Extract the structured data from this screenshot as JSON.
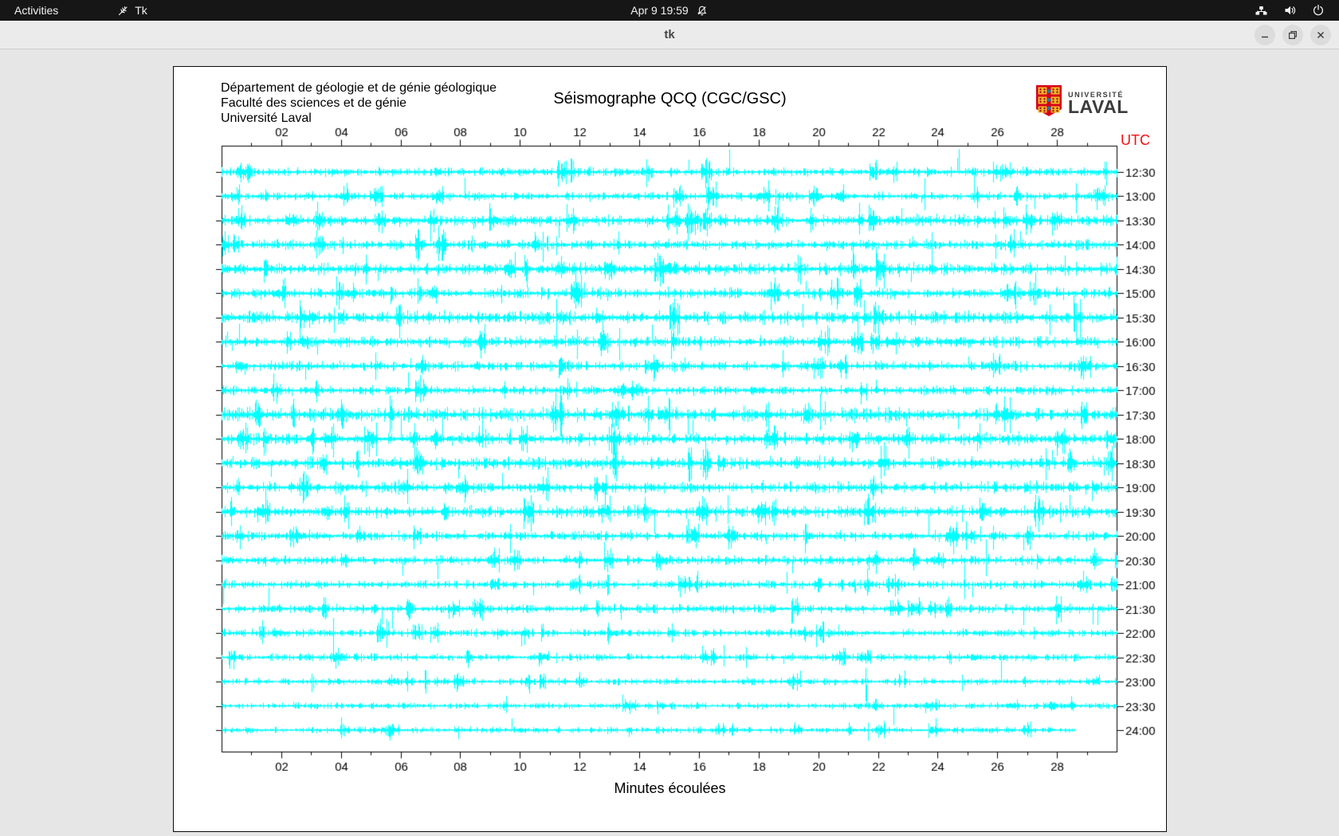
{
  "top_bar": {
    "activities_label": "Activities",
    "app_name": "Tk",
    "clock": "Apr 9 19:59",
    "icons": [
      "tk-feather-icon",
      "bell-muted-icon",
      "network-tree-icon",
      "speaker-icon",
      "power-icon"
    ]
  },
  "window": {
    "title": "tk",
    "buttons": [
      "minimize",
      "maximize",
      "close"
    ]
  },
  "chart": {
    "header_lines": [
      "Département de géologie et de génie géologique",
      "Faculté des sciences et de génie",
      "Université Laval"
    ],
    "title": "Séismographe QCQ (CGC/GSC)",
    "logo": {
      "line1": "UNIVERSITÉ",
      "line2": "LAVAL"
    },
    "utc_label": "UTC",
    "xlabel": "Minutes écoulées",
    "colors": {
      "trace": "#00ffff",
      "utc_label": "#f21111",
      "axis": "#000000",
      "shield_red": "#d6001c",
      "shield_gold": "#f2b626",
      "shield_blue": "#1878be"
    }
  },
  "chart_data": {
    "type": "line",
    "subtype": "helicorder-seismogram",
    "station": "QCQ (CGC/GSC)",
    "x_range_minutes": [
      0,
      30
    ],
    "x_tick_labels": [
      "02",
      "04",
      "06",
      "08",
      "10",
      "12",
      "14",
      "16",
      "18",
      "20",
      "22",
      "24",
      "26",
      "28"
    ],
    "x_minor_tick_step_minutes": 1,
    "xlabel": "Minutes écoulées",
    "row_interval_minutes": 30,
    "timezone_label": "UTC",
    "grid": false,
    "row_labels": [
      "12:30",
      "13:00",
      "13:30",
      "14:00",
      "14:30",
      "15:00",
      "15:30",
      "16:00",
      "16:30",
      "17:00",
      "17:30",
      "18:00",
      "18:30",
      "19:00",
      "19:30",
      "20:00",
      "20:30",
      "21:00",
      "21:30",
      "22:00",
      "22:30",
      "23:00",
      "23:30",
      "24:00"
    ],
    "traces": [
      {
        "label": "12:30",
        "seed": 1,
        "amp": 1.7,
        "spike_rate": 0.005,
        "spike_max": 22,
        "end_minute": 30
      },
      {
        "label": "13:00",
        "seed": 2,
        "amp": 1.7,
        "spike_rate": 0.005,
        "spike_max": 18,
        "end_minute": 30
      },
      {
        "label": "13:30",
        "seed": 3,
        "amp": 2.2,
        "spike_rate": 0.006,
        "spike_max": 16,
        "end_minute": 30
      },
      {
        "label": "14:00",
        "seed": 4,
        "amp": 1.9,
        "spike_rate": 0.005,
        "spike_max": 20,
        "end_minute": 30
      },
      {
        "label": "14:30",
        "seed": 5,
        "amp": 2.3,
        "spike_rate": 0.006,
        "spike_max": 18,
        "end_minute": 30
      },
      {
        "label": "15:00",
        "seed": 6,
        "amp": 2.1,
        "spike_rate": 0.006,
        "spike_max": 20,
        "end_minute": 30
      },
      {
        "label": "15:30",
        "seed": 7,
        "amp": 2.5,
        "spike_rate": 0.005,
        "spike_max": 18,
        "end_minute": 30
      },
      {
        "label": "16:00",
        "seed": 8,
        "amp": 2.1,
        "spike_rate": 0.006,
        "spike_max": 22,
        "end_minute": 30
      },
      {
        "label": "16:30",
        "seed": 9,
        "amp": 1.9,
        "spike_rate": 0.005,
        "spike_max": 16,
        "end_minute": 30
      },
      {
        "label": "17:00",
        "seed": 10,
        "amp": 1.7,
        "spike_rate": 0.004,
        "spike_max": 16,
        "end_minute": 30
      },
      {
        "label": "17:30",
        "seed": 11,
        "amp": 2.7,
        "spike_rate": 0.006,
        "spike_max": 18,
        "end_minute": 30
      },
      {
        "label": "18:00",
        "seed": 12,
        "amp": 2.3,
        "spike_rate": 0.006,
        "spike_max": 20,
        "end_minute": 30
      },
      {
        "label": "18:30",
        "seed": 13,
        "amp": 2.4,
        "spike_rate": 0.006,
        "spike_max": 18,
        "end_minute": 30
      },
      {
        "label": "19:00",
        "seed": 14,
        "amp": 2.1,
        "spike_rate": 0.005,
        "spike_max": 18,
        "end_minute": 30
      },
      {
        "label": "19:30",
        "seed": 15,
        "amp": 2.2,
        "spike_rate": 0.006,
        "spike_max": 24,
        "end_minute": 30
      },
      {
        "label": "20:00",
        "seed": 16,
        "amp": 1.9,
        "spike_rate": 0.005,
        "spike_max": 26,
        "end_minute": 30
      },
      {
        "label": "20:30",
        "seed": 17,
        "amp": 1.8,
        "spike_rate": 0.005,
        "spike_max": 20,
        "end_minute": 30
      },
      {
        "label": "21:00",
        "seed": 18,
        "amp": 1.6,
        "spike_rate": 0.005,
        "spike_max": 24,
        "end_minute": 30
      },
      {
        "label": "21:30",
        "seed": 19,
        "amp": 1.7,
        "spike_rate": 0.005,
        "spike_max": 26,
        "end_minute": 30
      },
      {
        "label": "22:00",
        "seed": 20,
        "amp": 1.5,
        "spike_rate": 0.005,
        "spike_max": 24,
        "end_minute": 30
      },
      {
        "label": "22:30",
        "seed": 21,
        "amp": 1.4,
        "spike_rate": 0.004,
        "spike_max": 26,
        "end_minute": 30
      },
      {
        "label": "23:00",
        "seed": 22,
        "amp": 1.3,
        "spike_rate": 0.004,
        "spike_max": 28,
        "end_minute": 30
      },
      {
        "label": "23:30",
        "seed": 23,
        "amp": 1.2,
        "spike_rate": 0.003,
        "spike_max": 30,
        "end_minute": 30
      },
      {
        "label": "24:00",
        "seed": 24,
        "amp": 1.2,
        "spike_rate": 0.003,
        "spike_max": 26,
        "end_minute": 28.6
      }
    ]
  }
}
